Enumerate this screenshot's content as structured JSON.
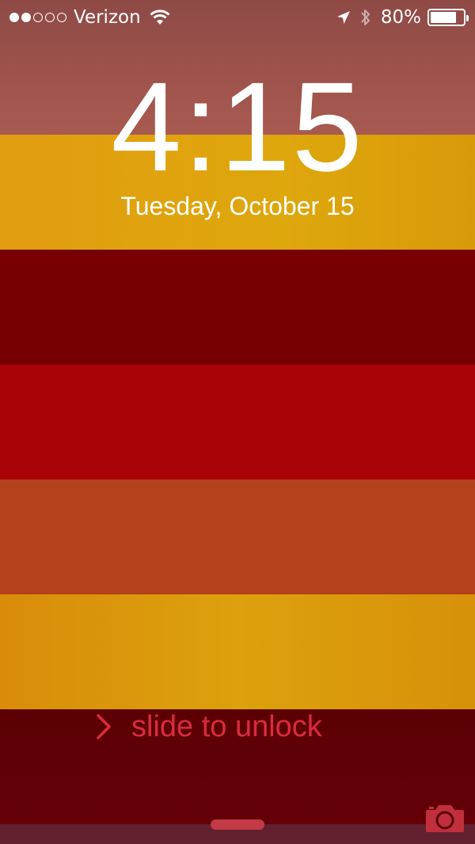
{
  "status_bar": {
    "signal_dots_filled": 2,
    "signal_dots_total": 5,
    "carrier": "Verizon",
    "wifi_icon": "wifi-icon",
    "location_icon": "location-arrow-icon",
    "bluetooth_icon": "bluetooth-icon",
    "battery_percent": "80%",
    "battery_level": 0.8
  },
  "lock_screen": {
    "time": "4:15",
    "date": "Tuesday, October 15",
    "slide_label": "slide to unlock",
    "slide_icon": "chevron-right-icon",
    "camera_icon": "camera-icon",
    "grabber_icon": "control-center-grabber"
  },
  "colors": {
    "stripe_1": "#a85a50",
    "stripe_2": "#dea70c",
    "stripe_3": "#760002",
    "stripe_4": "#a80306",
    "stripe_5": "#b3411c",
    "stripe_6": "#dca10c",
    "stripe_7": "#600006",
    "slide_text": "#d92c3c"
  }
}
